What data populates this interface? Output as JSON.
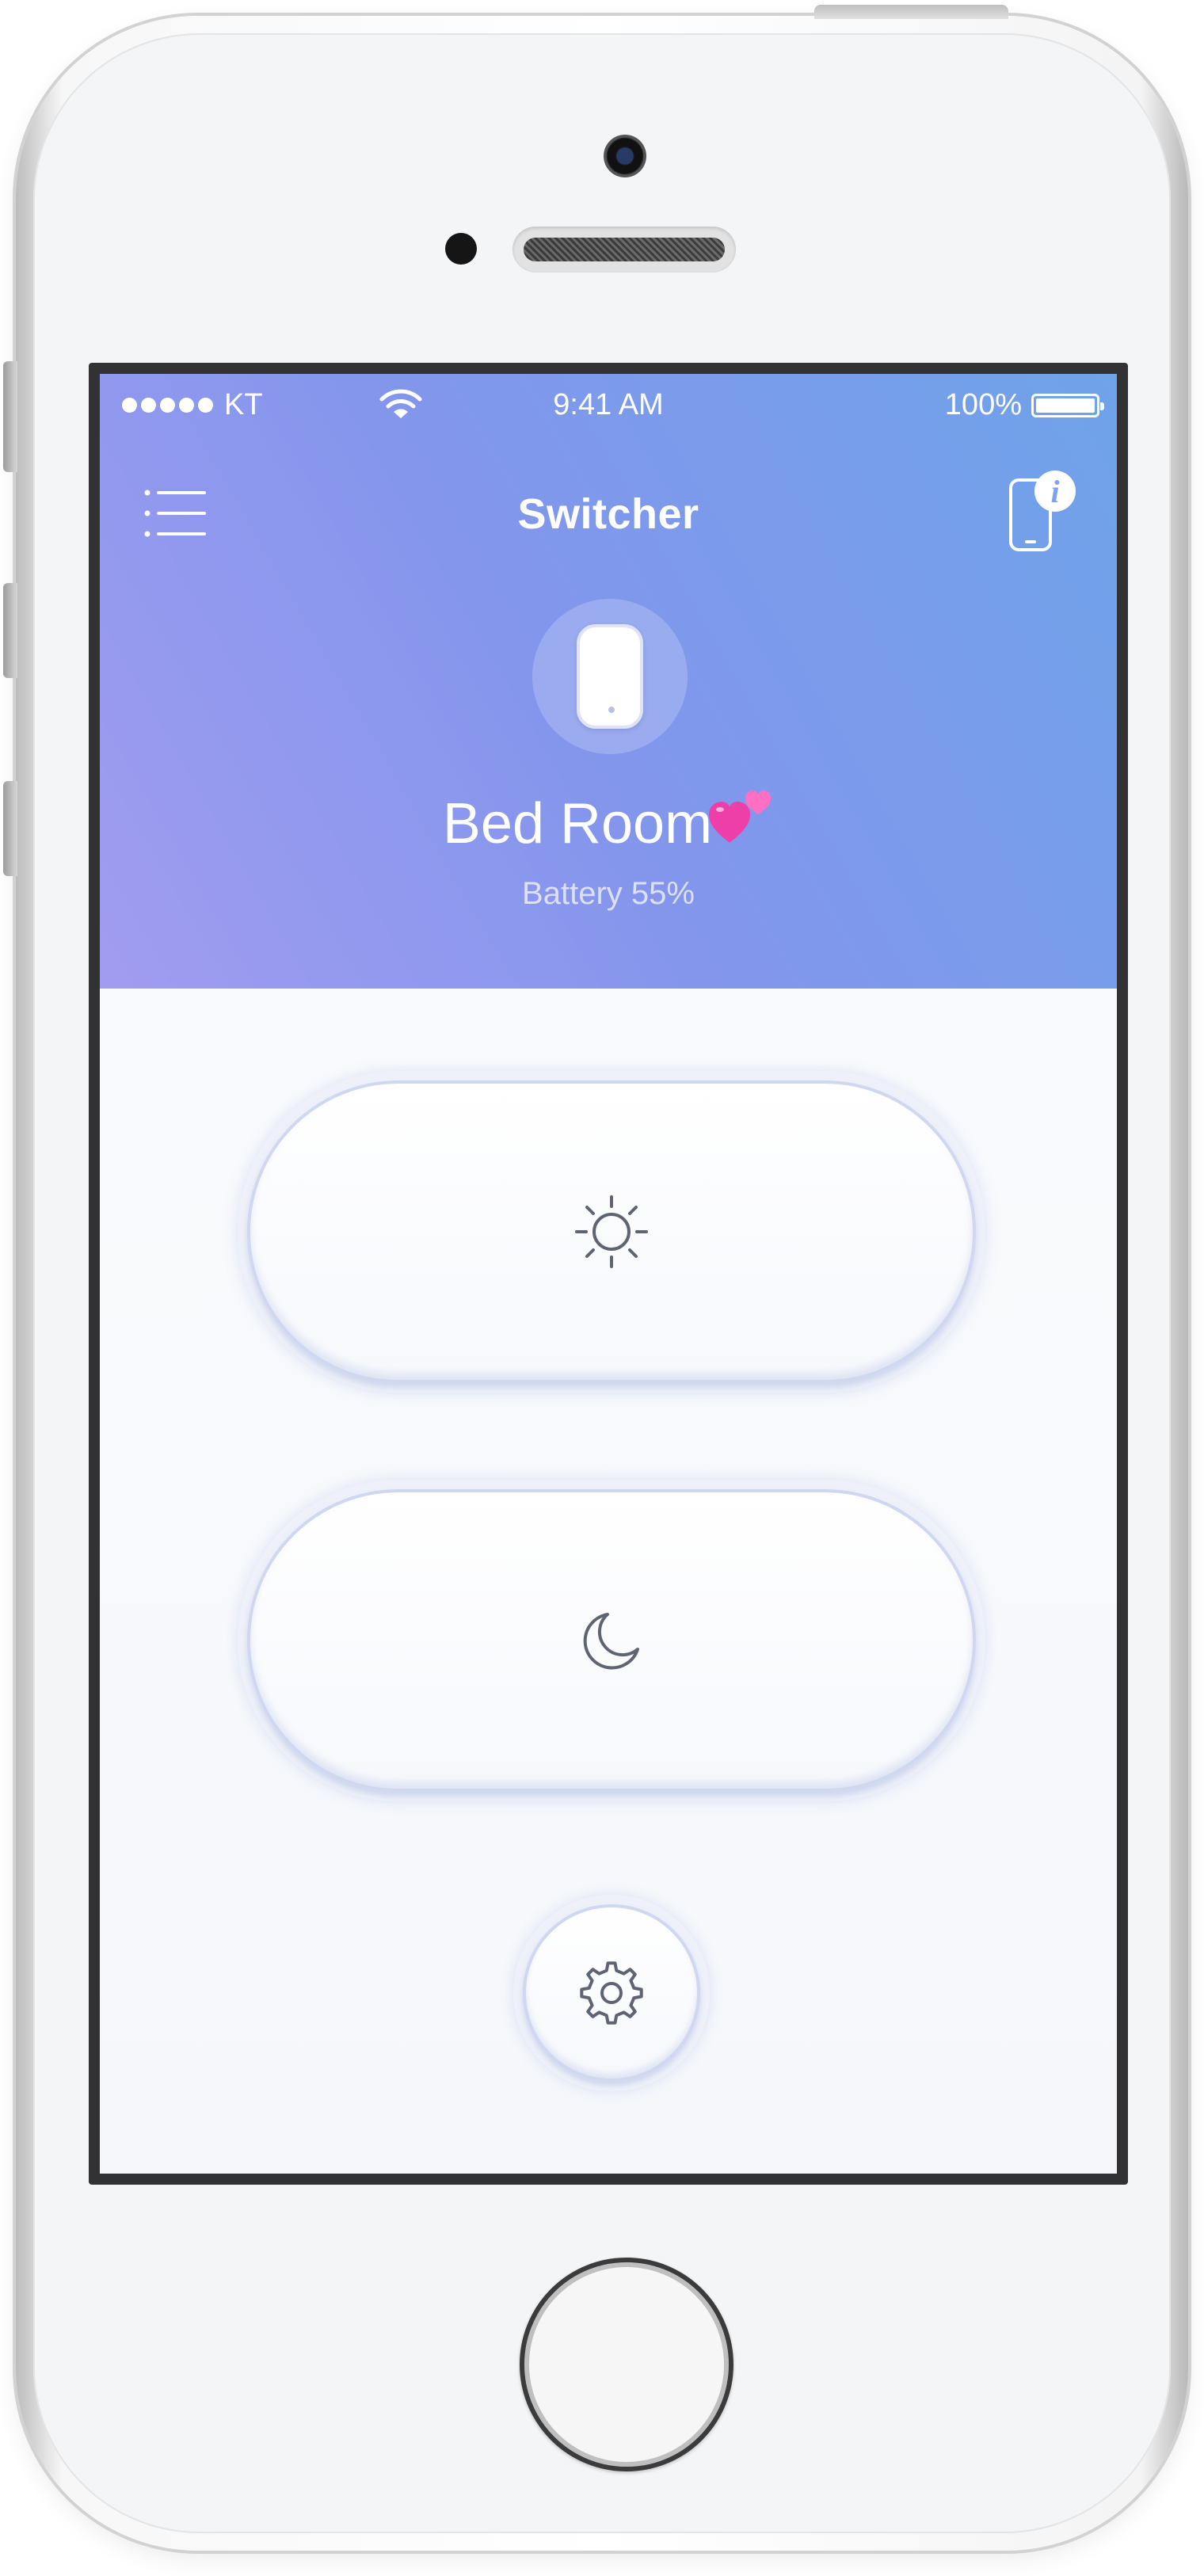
{
  "status_bar": {
    "carrier": "KT",
    "time": "9:41 AM",
    "battery_percent": "100%",
    "battery_level": 1.0,
    "signal_bars": 5
  },
  "nav": {
    "title": "Switcher",
    "menu_icon": "list-menu-icon",
    "right_icon": "device-info-icon"
  },
  "device": {
    "name": "Bed Room",
    "name_emoji": "two-hearts-icon",
    "battery": "Battery 55%",
    "battery_level": 0.55,
    "icon": "switch-device-icon"
  },
  "controls": {
    "on_icon": "sun-icon",
    "off_icon": "moon-icon",
    "settings_icon": "gear-icon"
  },
  "colors": {
    "header_gradient_start": "#a19cf0",
    "header_gradient_end": "#6fa3ea",
    "icon_stroke": "#5f6473",
    "pill_border": "#cfd8f0"
  }
}
